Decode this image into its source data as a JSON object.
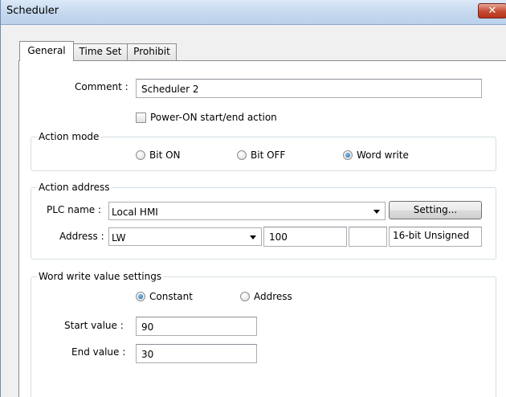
{
  "window": {
    "title": "Scheduler",
    "close_glyph": "✕"
  },
  "tabs": [
    {
      "label": "General",
      "active": true
    },
    {
      "label": "Time Set",
      "active": false
    },
    {
      "label": "Prohibit",
      "active": false
    }
  ],
  "general": {
    "comment_label": "Comment :",
    "comment_value": "Scheduler 2",
    "power_on_label": "Power-ON start/end action",
    "power_on_checked": false
  },
  "action_mode": {
    "title": "Action mode",
    "options": [
      {
        "label": "Bit ON",
        "selected": false
      },
      {
        "label": "Bit OFF",
        "selected": false
      },
      {
        "label": "Word write",
        "selected": true
      }
    ]
  },
  "action_address": {
    "title": "Action address",
    "plc_label": "PLC name :",
    "plc_value": "Local HMI",
    "setting_button": "Setting...",
    "address_label": "Address :",
    "address_device": "LW",
    "address_number": "100",
    "data_format": "16-bit Unsigned"
  },
  "word_write": {
    "title": "Word write value settings",
    "options": [
      {
        "label": "Constant",
        "selected": true
      },
      {
        "label": "Address",
        "selected": false
      }
    ],
    "start_label": "Start value :",
    "start_value": "90",
    "end_label": "End value :",
    "end_value": "30"
  },
  "colors": {
    "accent": "#1d5fa7",
    "close": "#c44a31",
    "titlebar": "#c3d7ee"
  }
}
